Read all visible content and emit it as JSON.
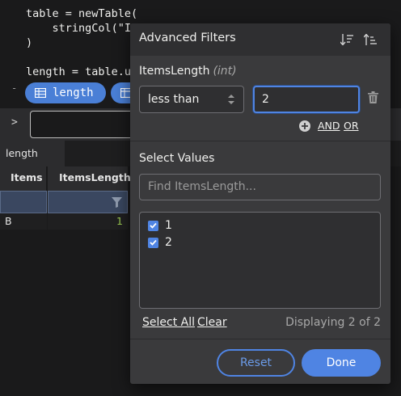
{
  "code": {
    "lines": [
      "table = newTable(",
      "    stringCol(\"Ite",
      ")",
      "length = table.upd"
    ],
    "gutter_mark": "-",
    "pill_primary": "length",
    "pill_secondary": ""
  },
  "console": {
    "prompt": ">"
  },
  "panel": {
    "tab": "length",
    "columns": [
      "Items",
      "ItemsLength"
    ],
    "row": {
      "items": "B",
      "items_length": "1"
    }
  },
  "dialog": {
    "title": "Advanced Filters",
    "column_name": "ItemsLength",
    "column_type": "(int)",
    "condition": "less than",
    "condition_value": "2",
    "and_label": "AND",
    "or_label": "OR",
    "select_values_title": "Select Values",
    "search_placeholder": "Find ItemsLength...",
    "values": [
      {
        "label": "1",
        "checked": true
      },
      {
        "label": "2",
        "checked": true
      }
    ],
    "select_all": "Select All",
    "clear": "Clear",
    "displaying": "Displaying 2 of 2",
    "reset": "Reset",
    "done": "Done"
  },
  "colors": {
    "accent": "#4f84e3",
    "dialog_bg": "#3a3a3c",
    "page_bg": "#1a1a1b"
  },
  "icons": [
    "table-icon",
    "sort-ascending-icon",
    "sort-descending-icon",
    "select-arrows-icon",
    "trash-icon",
    "add-circle-icon",
    "checkbox-checked-icon",
    "filter-icon"
  ]
}
